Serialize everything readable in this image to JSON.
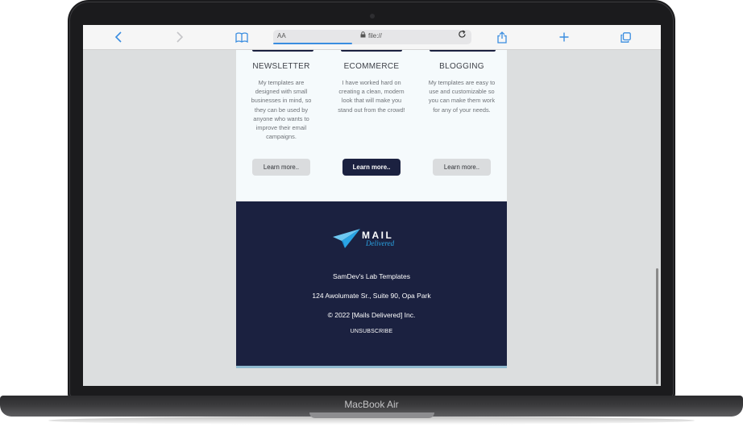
{
  "device": {
    "model": "MacBook Air"
  },
  "browser": {
    "address_prefix": "AA",
    "url": "file://",
    "icons": [
      "back-icon",
      "forward-icon",
      "bookmarks-icon",
      "lock-icon",
      "reload-icon",
      "share-icon",
      "new-tab-icon",
      "tabs-overview-icon"
    ]
  },
  "email": {
    "columns": [
      {
        "title": "NEWSLETTER",
        "text": "My templates are designed with small businesses in mind, so they can be used by anyone who wants to improve their email campaigns.",
        "button": "Learn more.."
      },
      {
        "title": "ECOMMERCE",
        "text": "I have worked hard on creating a clean, modern look that will make you stand out from the crowd!",
        "button": "Learn more.."
      },
      {
        "title": "BLOGGING",
        "text": "My templates are easy to use and customizable so you can make them work for any of your needs.",
        "button": "Learn more.."
      }
    ],
    "footer": {
      "logo_main": "MAIL",
      "logo_sub": "Delivered",
      "company": "SamDev's Lab Templates",
      "address": "124 Awolumate Sr., Suite 90, Opa Park",
      "copyright": "© 2022 [Mails Delivered] Inc.",
      "unsubscribe": "UNSUBSCRIBE"
    }
  },
  "colors": {
    "navy": "#1b2140",
    "accent_blue": "#3a8de0",
    "logo_blue": "#2aa4e4",
    "button_gray": "#dadcde"
  }
}
